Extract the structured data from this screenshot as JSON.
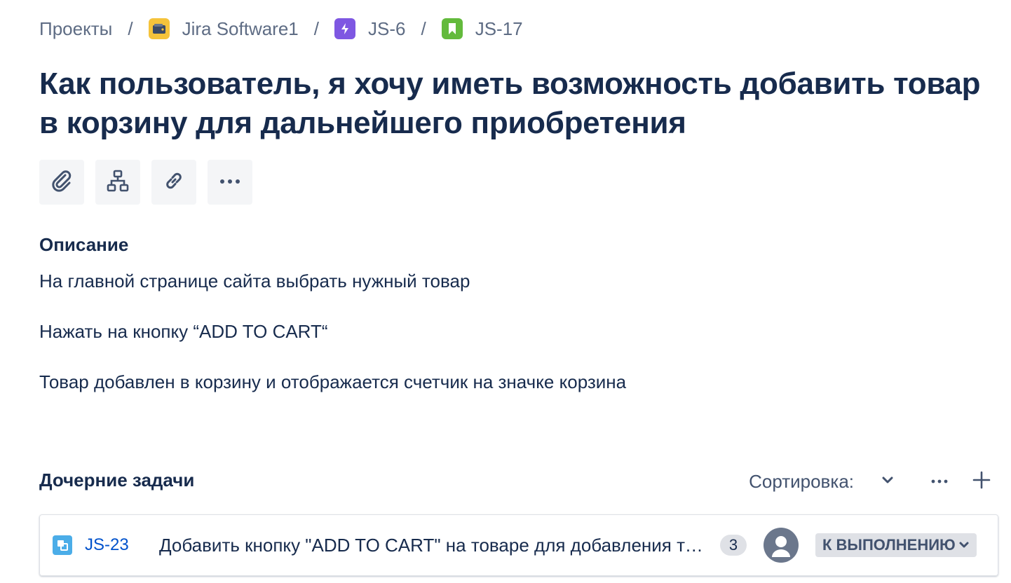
{
  "breadcrumb": {
    "items": [
      {
        "label": "Проекты"
      },
      {
        "label": "Jira Software1",
        "icon": "project-icon"
      },
      {
        "label": "JS-6",
        "icon": "epic-icon"
      },
      {
        "label": "JS-17",
        "icon": "story-icon"
      }
    ],
    "separator": "/"
  },
  "issue": {
    "title": "Как пользователь, я хочу иметь возможность добавить товар в корзину для дальнейшего приобретения"
  },
  "toolbar": {
    "buttons": [
      "attachment-icon",
      "child-issue-icon",
      "link-icon",
      "more-icon"
    ]
  },
  "description": {
    "heading": "Описание",
    "lines": [
      "На главной странице сайта выбрать нужный товар",
      "Нажать на кнопку “ADD TO CART“",
      "Товар добавлен в корзину и отображается счетчик на значке корзина"
    ]
  },
  "child_issues": {
    "heading": "Дочерние задачи",
    "sort_label": "Сортировка:",
    "items": [
      {
        "key": "JS-23",
        "summary": "Добавить кнопку \"ADD TO CART\" на товаре для добавления товара в корзину",
        "count": "3",
        "status": "К ВЫПОЛНЕНИЮ"
      }
    ]
  },
  "colors": {
    "text": "#172b4d",
    "link": "#0052cc",
    "muted": "#5e6c84",
    "project_icon": "#f5c33b",
    "epic_icon": "#7e57e2",
    "story_icon": "#63ba3c",
    "subtask_icon": "#4bade8"
  }
}
